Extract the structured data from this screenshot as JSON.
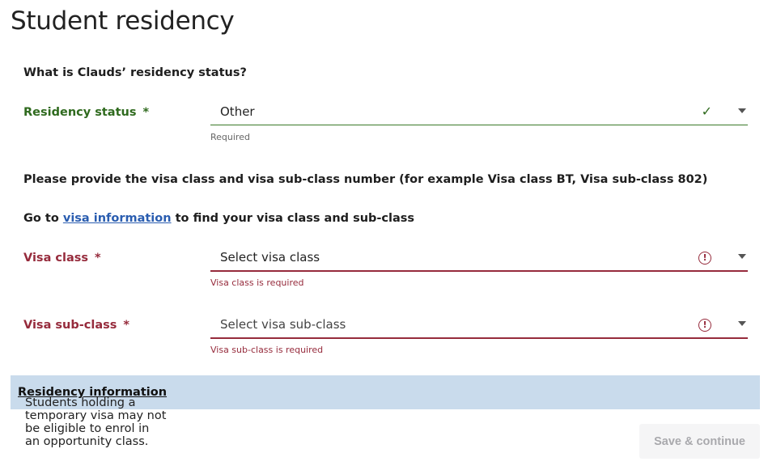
{
  "page": {
    "title": "Student residency"
  },
  "question": "What is Clauds’ residency status?",
  "residency": {
    "label": "Residency status",
    "required_mark": "*",
    "value": "Other",
    "help": "Required",
    "status_icon": "check-icon"
  },
  "instructions": {
    "visa_text": "Please provide the visa class and visa sub-class number (for example Visa class BT, Visa sub-class 802)",
    "goto_prefix": "Go to",
    "goto_link": "visa information",
    "goto_suffix": "to find your visa class and sub-class"
  },
  "visa_class": {
    "label": "Visa class",
    "required_mark": "*",
    "placeholder": "Select visa class",
    "error": "Visa class is required",
    "status_icon": "error-icon"
  },
  "visa_subclass": {
    "label": "Visa sub-class",
    "required_mark": "*",
    "placeholder": "Select visa sub-class",
    "error": "Visa sub-class is required",
    "status_icon": "error-icon"
  },
  "info_banner": {
    "text": "Students holding a temporary visa may not be eligible to enrol in an opportunity class.",
    "link": "Residency information"
  },
  "actions": {
    "save_label": "Save & continue"
  },
  "colors": {
    "valid": "#2f6a1e",
    "error": "#962b3c",
    "banner": "#c9dbec",
    "link": "#2a5db0"
  }
}
